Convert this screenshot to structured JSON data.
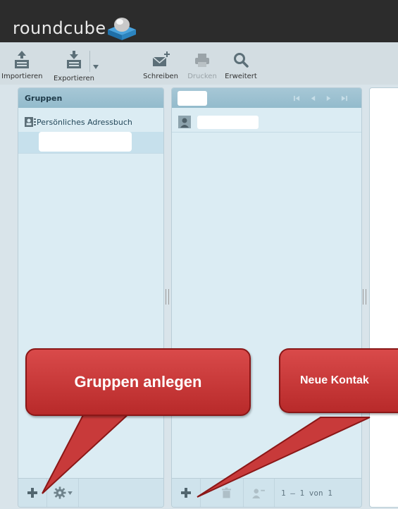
{
  "app": {
    "logo_text": "roundcube"
  },
  "toolbar": {
    "import_label": "Importieren",
    "export_label": "Exportieren",
    "compose_label": "Schreiben",
    "print_label": "Drucken",
    "advanced_label": "Erweitert"
  },
  "groups": {
    "header": "Gruppen",
    "addressbook_label": "Persönliches Adressbuch"
  },
  "contacts": {
    "pager_text": "1 – 1 von 1"
  },
  "annotations": {
    "groups_callout": "Gruppen anlegen",
    "contact_callout": "Neue Kontak"
  },
  "colors": {
    "topbar": "#2c2c2c",
    "panel": "#dbecf3",
    "panel_header": "#9ec2d2",
    "callout": "#c83a3a"
  }
}
